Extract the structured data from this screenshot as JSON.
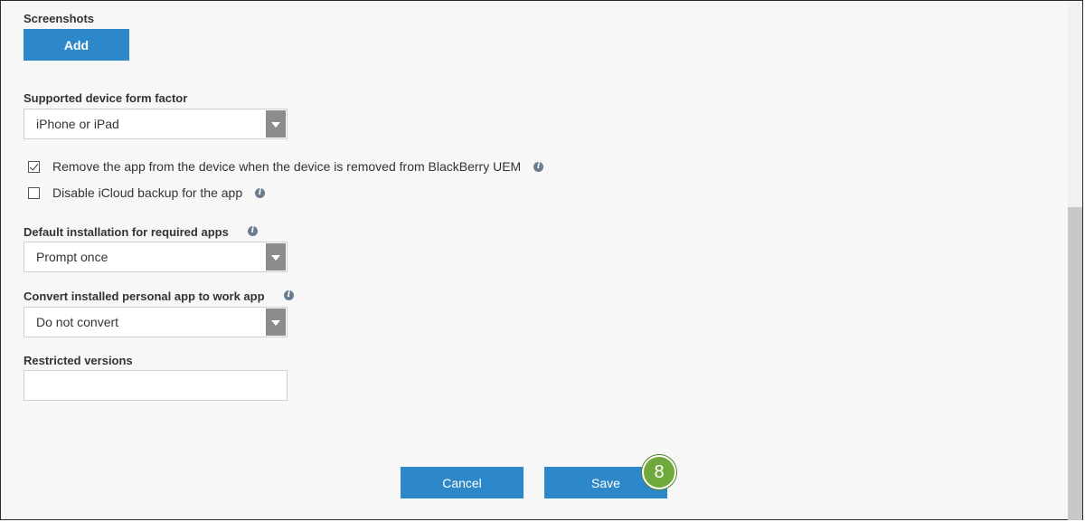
{
  "screenshots": {
    "label": "Screenshots",
    "add_label": "Add"
  },
  "form_factor": {
    "label": "Supported device form factor",
    "value": "iPhone or iPad"
  },
  "checkboxes": [
    {
      "label": "Remove the app from the device when the device is removed from BlackBerry UEM",
      "checked": true
    },
    {
      "label": "Disable iCloud backup for the app",
      "checked": false
    }
  ],
  "default_install": {
    "label": "Default installation for required apps",
    "value": "Prompt once"
  },
  "convert": {
    "label": "Convert installed personal app to work app",
    "value": "Do not convert"
  },
  "restricted": {
    "label": "Restricted versions",
    "value": "",
    "placeholder": ""
  },
  "actions": {
    "cancel_label": "Cancel",
    "save_label": "Save"
  },
  "callout": {
    "number": "8"
  },
  "icons": {
    "info": "info-icon",
    "dropdown": "chevron-down-icon"
  },
  "colors": {
    "primary_button": "#2d88c9",
    "callout": "#70a83b",
    "dropdown_arrow_bg": "#8c8c8c"
  },
  "info_glyph": "i"
}
